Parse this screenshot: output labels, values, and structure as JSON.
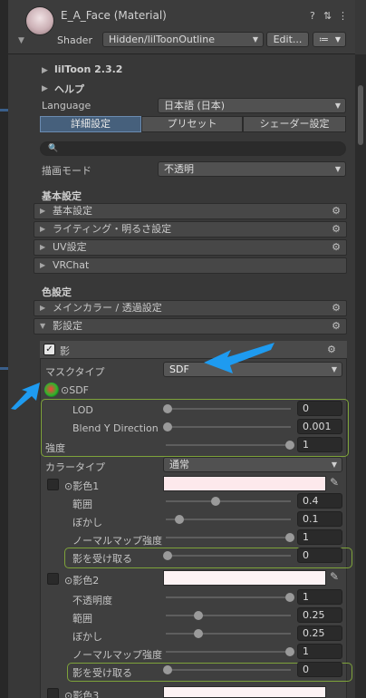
{
  "header": {
    "title": "E_A_Face (Material)",
    "shader_label": "Shader",
    "shader_value": "Hidden/lilToonOutline",
    "edit_label": "Edit...",
    "help_icon": "?",
    "settings_icon": "⇅",
    "more_icon": "⋮"
  },
  "top": {
    "liltoon_version": "lilToon 2.3.2",
    "help_label": "ヘルプ",
    "language_label": "Language",
    "language_value": "日本語 (日本)",
    "tabs": [
      "詳細設定",
      "プリセット",
      "シェーダー設定"
    ],
    "search_icon": "🔍",
    "render_mode_label": "描画モード",
    "render_mode_value": "不透明"
  },
  "basic": {
    "heading": "基本設定",
    "items": [
      "基本設定",
      "ライティング・明るさ設定",
      "UV設定",
      "VRChat"
    ]
  },
  "color": {
    "heading": "色設定",
    "items": [
      "メインカラー / 透過設定",
      "影設定"
    ]
  },
  "shadow": {
    "enable_label": "影",
    "mask_type_label": "マスクタイプ",
    "mask_type_value": "SDF",
    "sdf_label": "SDF",
    "lod_label": "LOD",
    "lod_value": "0",
    "blend_label": "Blend Y Direction",
    "blend_value": "0.001",
    "strength_label": "強度",
    "strength_value": "1",
    "color_type_label": "カラータイプ",
    "color_type_value": "通常",
    "shade1": {
      "label": "影色1",
      "color": "#fde9ec",
      "range_label": "範囲",
      "range_value": "0.4",
      "blur_label": "ぼかし",
      "blur_value": "0.1",
      "normal_label": "ノーマルマップ強度",
      "normal_value": "1",
      "receive_label": "影を受け取る",
      "receive_value": "0"
    },
    "shade2": {
      "label": "影色2",
      "color": "#fdf3f4",
      "opacity_label": "不透明度",
      "opacity_value": "1",
      "range_label": "範囲",
      "range_value": "0.25",
      "blur_label": "ぼかし",
      "blur_value": "0.25",
      "normal_label": "ノーマルマップ強度",
      "normal_value": "1",
      "receive_label": "影を受け取る",
      "receive_value": "0"
    },
    "shade3": {
      "label": "影色3",
      "color": "#fdf3f4"
    }
  }
}
